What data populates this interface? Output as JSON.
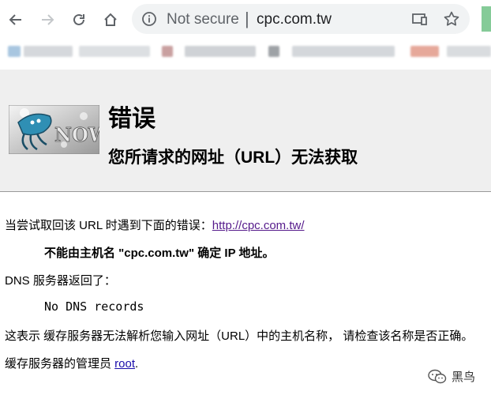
{
  "browser": {
    "security_label": "Not secure",
    "separator": "|",
    "url": "cpc.com.tw"
  },
  "error_page": {
    "title": "错误",
    "subtitle": "您所请求的网址（URL）无法获取",
    "logo_text": "NOW",
    "line1_prefix": "当尝试取回该 URL 时遇到下面的错误：",
    "line1_link": "http://cpc.com.tw/",
    "line2_prefix": "不能由主机名 ",
    "line2_host": "\"cpc.com.tw\"",
    "line2_suffix": " 确定 IP 地址。",
    "line3": "DNS 服务器返回了：",
    "line4": "No DNS records",
    "line5": "这表示 缓存服务器无法解析您输入网址（URL）中的主机名称， 请检查该名称是否正确。",
    "line6_prefix": "缓存服务器的管理员 ",
    "line6_link": "root",
    "line6_suffix": "."
  },
  "watermark": {
    "text": "黑鸟"
  }
}
